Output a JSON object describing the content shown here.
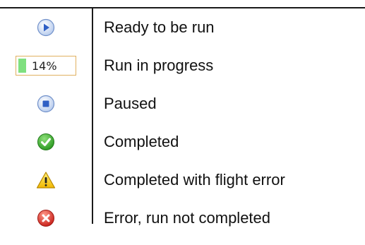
{
  "legend": {
    "rows": [
      {
        "icon": "play-circle-icon",
        "label": "Ready to be run"
      },
      {
        "icon": "progress-bar",
        "progress": {
          "value_percent": 14,
          "text": "14%",
          "fill_color": "#7fe07f"
        },
        "label": "Run in progress"
      },
      {
        "icon": "stop-circle-icon",
        "label": "Paused"
      },
      {
        "icon": "check-circle-icon",
        "label": "Completed"
      },
      {
        "icon": "warning-triangle-icon",
        "label": "Completed with flight error"
      },
      {
        "icon": "error-x-circle-icon",
        "label": "Error, run not completed"
      }
    ]
  },
  "colors": {
    "blue_icon": "#3b6fd0",
    "success_green": "#3cae2c",
    "warning_yellow": "#f5c400",
    "error_red": "#d9332c",
    "rule": "#1a1a1a"
  }
}
